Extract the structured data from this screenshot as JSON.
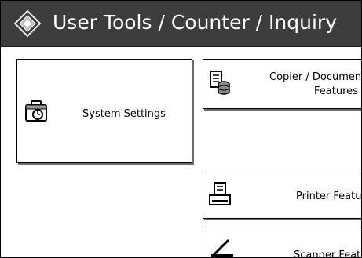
{
  "header": {
    "title": "User Tools / Counter / Inquiry",
    "icon": "diamond-menu-icon"
  },
  "buttons": {
    "system_settings": {
      "label": "System Settings",
      "icon": "toolbox-clock-icon"
    },
    "copier": {
      "line1": "Copier / Document",
      "line2": "Features",
      "icon": "document-stack-icon"
    },
    "printer": {
      "label": "Printer Features",
      "icon": "printer-icon"
    },
    "scanner": {
      "label": "Scanner Features",
      "icon": "scanner-icon"
    }
  },
  "colors": {
    "titlebar": "#3d3d3d",
    "title_text": "#ffffff",
    "button_border": "#000000"
  }
}
